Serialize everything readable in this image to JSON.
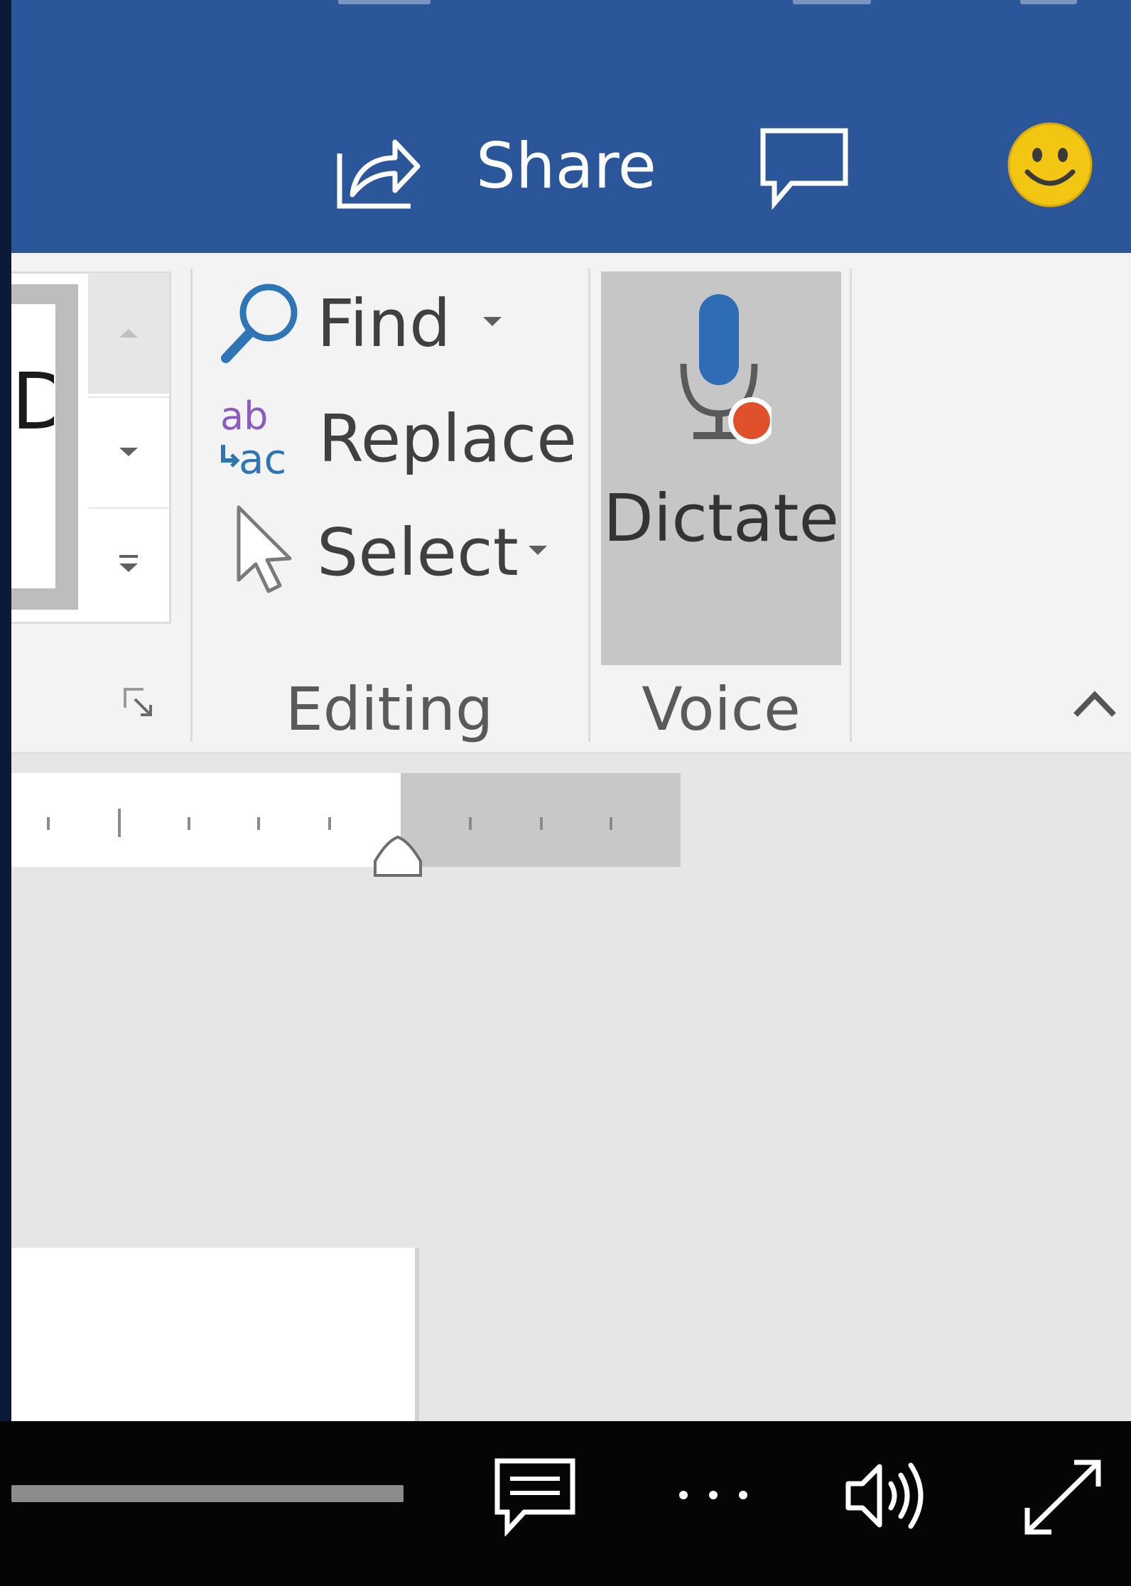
{
  "titlebar": {
    "share_label": "Share",
    "share_icon": "share-icon",
    "comments_icon": "comment-icon",
    "feedback_icon": "smiley-icon"
  },
  "ribbon": {
    "styles_gallery_partial_char": "D",
    "editing": {
      "group_label": "Editing",
      "find_label": "Find",
      "replace_label": "Replace",
      "select_label": "Select"
    },
    "voice": {
      "group_label": "Voice",
      "dictate_label": "Dictate",
      "dictate_icon": "microphone-icon"
    }
  },
  "player": {
    "icons": [
      "captions-icon",
      "more-icon",
      "volume-icon",
      "fullscreen-icon"
    ],
    "more_label": "• • •"
  },
  "colors": {
    "titlebar_blue": "#2b579a",
    "record_dot": "#e0502a",
    "smiley_yellow": "#f3c613"
  }
}
